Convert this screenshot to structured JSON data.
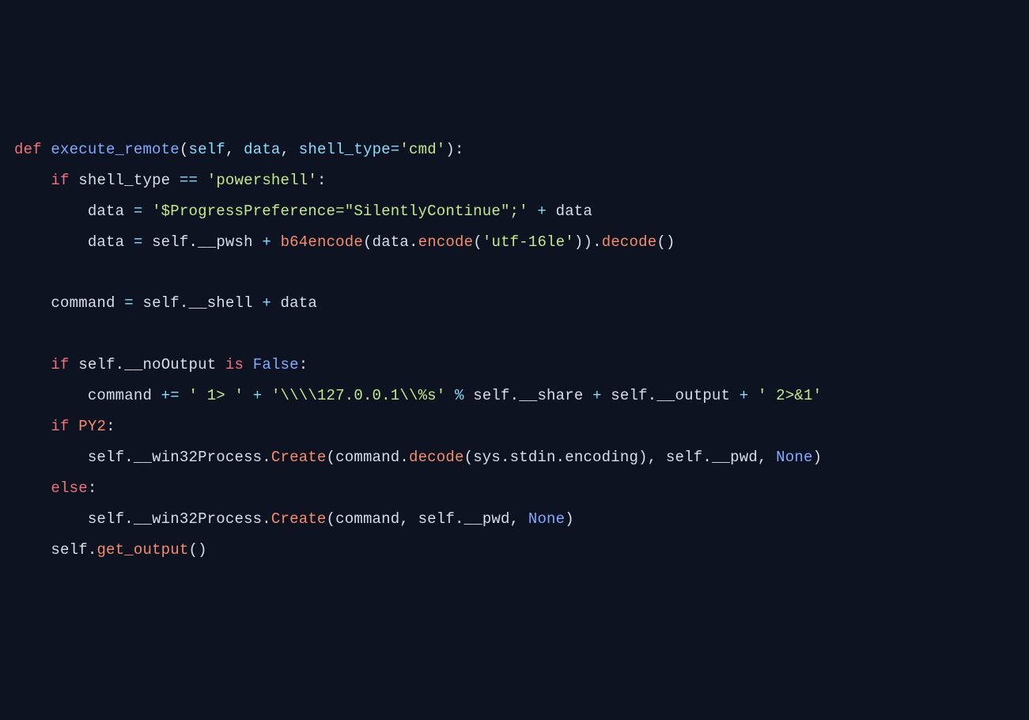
{
  "code": {
    "l1": {
      "def": "def",
      "fname": "execute_remote",
      "lp": "(",
      "self": "self",
      "c1": ",",
      "sp1": " ",
      "data": "data",
      "c2": ",",
      "sp2": " ",
      "shell_type": "shell_type",
      "eq": "=",
      "str": "'cmd'",
      "rp": ")",
      "colon": ":"
    },
    "l2": {
      "indent": "    ",
      "if": "if",
      "sp": " ",
      "shell_type": "shell_type",
      "sp2": " ",
      "eq": "==",
      "sp3": " ",
      "str": "'powershell'",
      "colon": ":"
    },
    "l3": {
      "indent": "        ",
      "data": "data",
      "sp": " ",
      "eq": "=",
      "sp2": " ",
      "str": "'$ProgressPreference=\"SilentlyContinue\";'",
      "sp3": " ",
      "plus": "+",
      "sp4": " ",
      "data2": "data"
    },
    "l4": {
      "indent": "        ",
      "data": "data",
      "sp": " ",
      "eq": "=",
      "sp2": " ",
      "self": "self",
      "dot": ".",
      "pwsh": "__pwsh",
      "sp3": " ",
      "plus": "+",
      "sp4": " ",
      "b64": "b64encode",
      "lp": "(",
      "data2": "data",
      "dot2": ".",
      "encode": "encode",
      "lp2": "(",
      "str": "'utf-16le'",
      "rp2": ")",
      "rp": ")",
      "dot3": ".",
      "decode": "decode",
      "lp3": "(",
      "rp3": ")"
    },
    "l5": "",
    "l6": {
      "indent": "    ",
      "command": "command",
      "sp": " ",
      "eq": "=",
      "sp2": " ",
      "self": "self",
      "dot": ".",
      "shell": "__shell",
      "sp3": " ",
      "plus": "+",
      "sp4": " ",
      "data": "data"
    },
    "l7": "",
    "l8": {
      "indent": "    ",
      "if": "if",
      "sp": " ",
      "self": "self",
      "dot": ".",
      "noout": "__noOutput",
      "sp2": " ",
      "is": "is",
      "sp3": " ",
      "false": "False",
      "colon": ":"
    },
    "l9": {
      "indent": "        ",
      "command": "command",
      "sp": " ",
      "op": "+=",
      "sp2": " ",
      "str1": "' 1> '",
      "sp3": " ",
      "plus": "+",
      "sp4": " ",
      "str2": "'\\\\\\\\127.0.0.1\\\\%s'",
      "sp5": " ",
      "pct": "%",
      "sp6": " ",
      "self": "self",
      "dot": ".",
      "share": "__share",
      "sp7": " ",
      "plus2": "+",
      "sp8": " ",
      "self2": "self",
      "dot2": ".",
      "output": "__output",
      "sp9": " ",
      "plus3": "+",
      "sp10": " ",
      "str3": "' 2>&1'"
    },
    "l10": {
      "indent": "    ",
      "if": "if",
      "sp": " ",
      "py2": "PY2",
      "colon": ":"
    },
    "l11": {
      "indent": "        ",
      "self": "self",
      "dot": ".",
      "w32": "__win32Process",
      "dot2": ".",
      "create": "Create",
      "lp": "(",
      "command": "command",
      "dot3": ".",
      "decode": "decode",
      "lp2": "(",
      "sys": "sys",
      "dot4": ".",
      "stdin": "stdin",
      "dot5": ".",
      "encoding": "encoding",
      "rp2": ")",
      "c": ",",
      "sp": " ",
      "self2": "self",
      "dot6": ".",
      "pwd": "__pwd",
      "c2": ",",
      "sp2": " ",
      "none": "None",
      "rp": ")"
    },
    "l12": {
      "indent": "    ",
      "else": "else",
      "colon": ":"
    },
    "l13": {
      "indent": "        ",
      "self": "self",
      "dot": ".",
      "w32": "__win32Process",
      "dot2": ".",
      "create": "Create",
      "lp": "(",
      "command": "command",
      "c": ",",
      "sp": " ",
      "self2": "self",
      "dot3": ".",
      "pwd": "__pwd",
      "c2": ",",
      "sp2": " ",
      "none": "None",
      "rp": ")"
    },
    "l14": {
      "indent": "    ",
      "self": "self",
      "dot": ".",
      "get_output": "get_output",
      "lp": "(",
      "rp": ")"
    }
  }
}
